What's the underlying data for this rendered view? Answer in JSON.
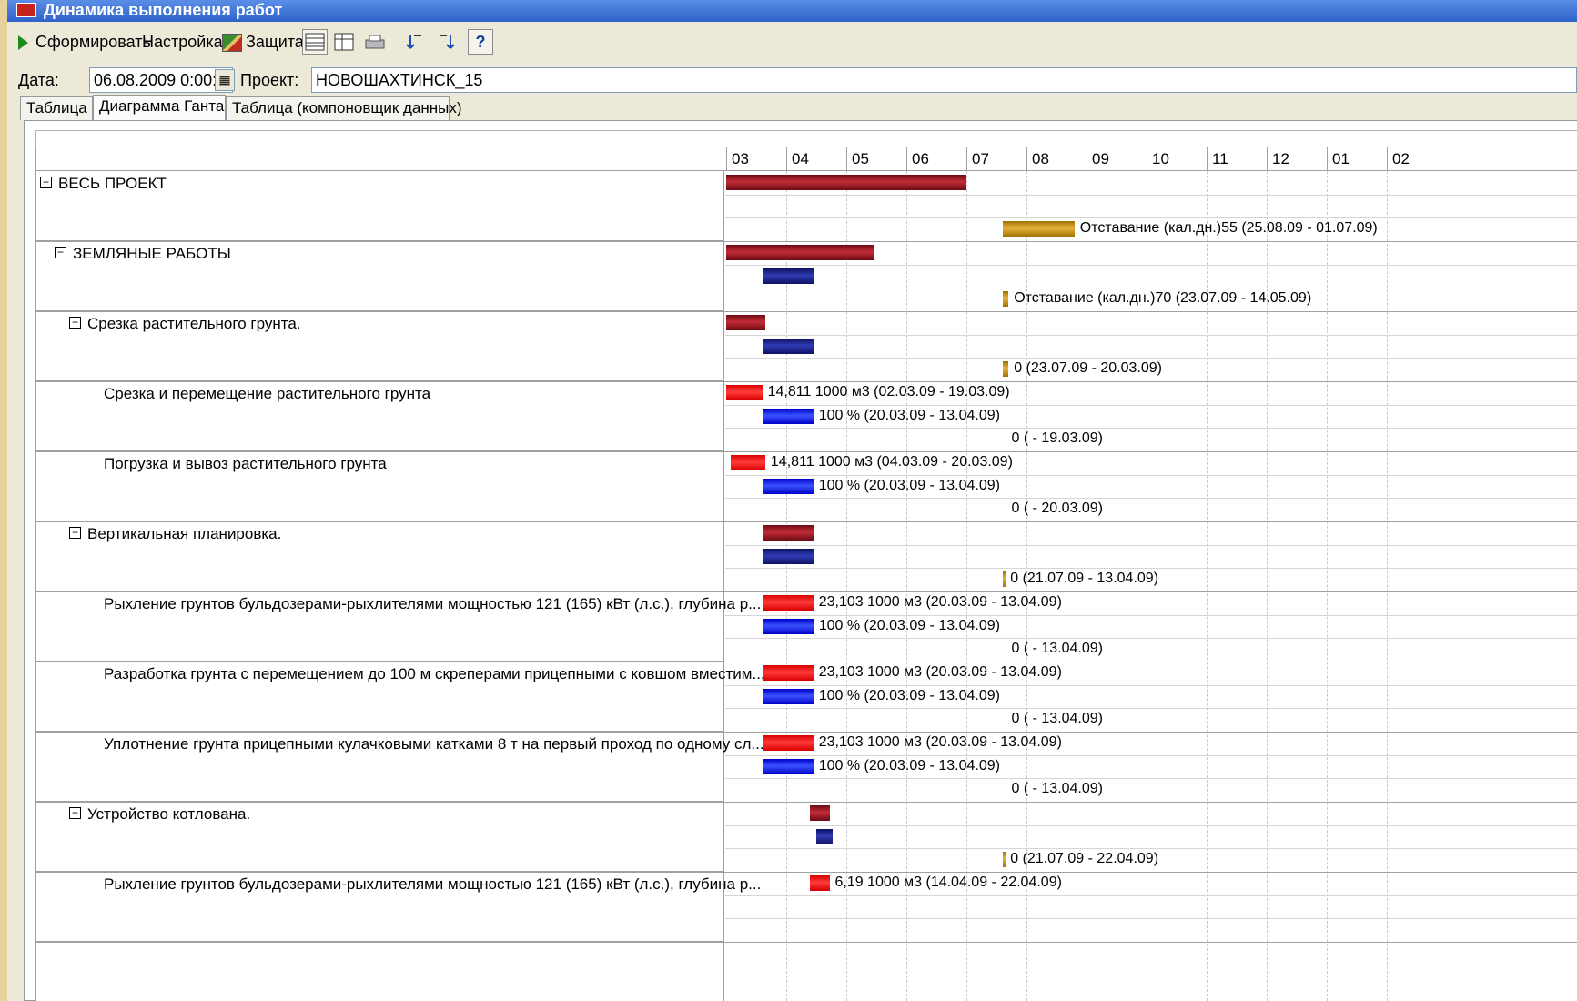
{
  "window": {
    "title": "Динамика выполнения работ"
  },
  "toolbar": {
    "generate_label": "Сформировать",
    "settings_label": "Настройка",
    "protect_label": "Защита",
    "help_label": "?"
  },
  "fields": {
    "date_label": "Дата:",
    "date_value": "06.08.2009  0:00:0(",
    "project_label": "Проект:",
    "project_value": "НОВОШАХТИНСК_15"
  },
  "tabs": [
    "Таблица",
    "Диаграмма Ганта",
    "Таблица (компоновщик данных)"
  ],
  "active_tab": 1,
  "months": [
    "03",
    "04",
    "05",
    "06",
    "07",
    "08",
    "09",
    "10",
    "11",
    "12",
    "01",
    "02"
  ],
  "rows": [
    {
      "label": "ВЕСЬ ПРОЕКТ",
      "level": 0,
      "collapsible": true,
      "plan": {
        "from": 0.0,
        "to": 4.0
      },
      "lag": {
        "from": 4.6,
        "to": 5.8,
        "text": "Отставание (кал.дн.)55 (25.08.09 - 01.07.09)"
      }
    },
    {
      "label": "ЗЕМЛЯНЫЕ РАБОТЫ",
      "level": 1,
      "collapsible": true,
      "plan": {
        "from": 0.0,
        "to": 2.45
      },
      "fact": {
        "from": 0.6,
        "to": 1.45
      },
      "lag": {
        "from": 4.6,
        "to": 4.7,
        "text": "Отставание (кал.дн.)70 (23.07.09 - 14.05.09)"
      }
    },
    {
      "label": "Срезка растительного грунта.",
      "level": 2,
      "collapsible": true,
      "plan": {
        "from": 0.0,
        "to": 0.65
      },
      "fact": {
        "from": 0.6,
        "to": 1.45
      },
      "lag": {
        "from": 4.6,
        "to": 4.7,
        "text": "0 (23.07.09 - 20.03.09)"
      }
    },
    {
      "label": "Срезка и перемещение растительного грунта",
      "level": 3,
      "collapsible": false,
      "plan": {
        "from": 0.0,
        "to": 0.6,
        "text": "14,811 1000 м3 (02.03.09 - 19.03.09)"
      },
      "fact": {
        "from": 0.6,
        "to": 1.45,
        "text": "100 % (20.03.09 - 13.04.09)"
      },
      "lag": {
        "text": "0 ( - 19.03.09)"
      }
    },
    {
      "label": "Погрузка и вывоз растительного грунта",
      "level": 3,
      "collapsible": false,
      "plan": {
        "from": 0.07,
        "to": 0.65,
        "text": "14,811 1000 м3 (04.03.09 - 20.03.09)"
      },
      "fact": {
        "from": 0.6,
        "to": 1.45,
        "text": "100 % (20.03.09 - 13.04.09)"
      },
      "lag": {
        "text": "0 ( - 20.03.09)"
      }
    },
    {
      "label": "Вертикальная планировка.",
      "level": 2,
      "collapsible": true,
      "plan": {
        "from": 0.6,
        "to": 1.45
      },
      "fact": {
        "from": 0.6,
        "to": 1.45
      },
      "lag": {
        "from": 4.6,
        "to": 4.64,
        "text": "0 (21.07.09 - 13.04.09)"
      }
    },
    {
      "label": "Рыхление грунтов бульдозерами-рыхлителями мощностью 121 (165) кВт (л.с.), глубина р...",
      "level": 3,
      "collapsible": false,
      "plan": {
        "from": 0.6,
        "to": 1.45,
        "text": "23,103 1000 м3 (20.03.09 - 13.04.09)"
      },
      "fact": {
        "from": 0.6,
        "to": 1.45,
        "text": "100 % (20.03.09 - 13.04.09)"
      },
      "lag": {
        "text": "0 ( - 13.04.09)"
      }
    },
    {
      "label": "Разработка грунта с перемещением до 100 м скреперами прицепными с ковшом вместим...",
      "level": 3,
      "collapsible": false,
      "plan": {
        "from": 0.6,
        "to": 1.45,
        "text": "23,103 1000 м3 (20.03.09 - 13.04.09)"
      },
      "fact": {
        "from": 0.6,
        "to": 1.45,
        "text": "100 % (20.03.09 - 13.04.09)"
      },
      "lag": {
        "text": "0 ( - 13.04.09)"
      }
    },
    {
      "label": "Уплотнение грунта прицепными кулачковыми катками 8 т на первый проход по одному сл...",
      "level": 3,
      "collapsible": false,
      "plan": {
        "from": 0.6,
        "to": 1.45,
        "text": "23,103 1000 м3 (20.03.09 - 13.04.09)"
      },
      "fact": {
        "from": 0.6,
        "to": 1.45,
        "text": "100 % (20.03.09 - 13.04.09)"
      },
      "lag": {
        "text": "0 ( - 13.04.09)"
      }
    },
    {
      "label": "Устройство котлована.",
      "level": 2,
      "collapsible": true,
      "plan": {
        "from": 1.4,
        "to": 1.72
      },
      "fact": {
        "from": 1.5,
        "to": 1.77
      },
      "lag": {
        "from": 4.6,
        "to": 4.64,
        "text": "0 (21.07.09 - 22.04.09)"
      }
    },
    {
      "label": "Рыхление грунтов бульдозерами-рыхлителями мощностью 121 (165) кВт (л.с.), глубина р...",
      "level": 3,
      "collapsible": false,
      "plan": {
        "from": 1.4,
        "to": 1.72,
        "text": "6,19 1000 м3 (14.04.09 - 22.04.09)"
      }
    }
  ]
}
